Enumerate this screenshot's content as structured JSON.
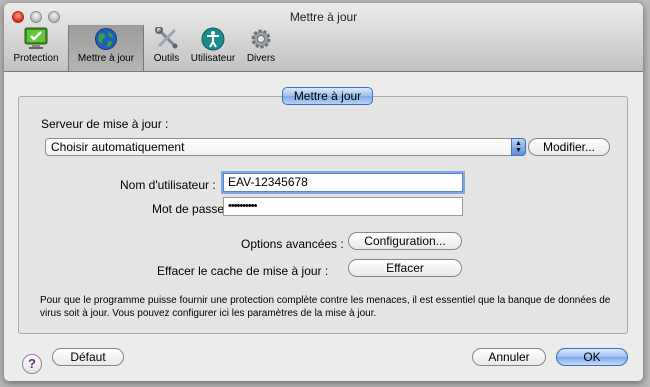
{
  "window": {
    "title": "Mettre à jour"
  },
  "toolbar": {
    "items": [
      {
        "label": "Protection",
        "icon": "protection-monitor-icon",
        "selected": false
      },
      {
        "label": "Mettre à jour",
        "icon": "globe-icon",
        "selected": true
      },
      {
        "label": "Outils",
        "icon": "tools-icon",
        "selected": false
      },
      {
        "label": "Utilisateur",
        "icon": "user-icon",
        "selected": false
      },
      {
        "label": "Divers",
        "icon": "gear-icon",
        "selected": false
      }
    ]
  },
  "panel": {
    "tab_label": "Mettre à jour",
    "server_label": "Serveur de mise à jour :",
    "server_select_value": "Choisir automatiquement",
    "modify_button": "Modifier...",
    "username_label": "Nom d'utilisateur :",
    "username_value": "EAV-12345678",
    "password_label": "Mot de passe :",
    "password_value": "••••••••••",
    "advanced_label": "Options avancées :",
    "config_button": "Configuration...",
    "clear_cache_label": "Effacer le cache de mise à jour :",
    "clear_button": "Effacer",
    "info_text": "Pour que le programme puisse fournir une protection complète contre les menaces, il est essentiel que la banque de données de virus soit à jour. Vous pouvez configurer ici les paramètres de la mise à jour."
  },
  "footer": {
    "help_symbol": "?",
    "default_button": "Défaut",
    "cancel_button": "Annuler",
    "ok_button": "OK"
  },
  "colors": {
    "accent": "#7faae6",
    "close": "#d9291c"
  }
}
